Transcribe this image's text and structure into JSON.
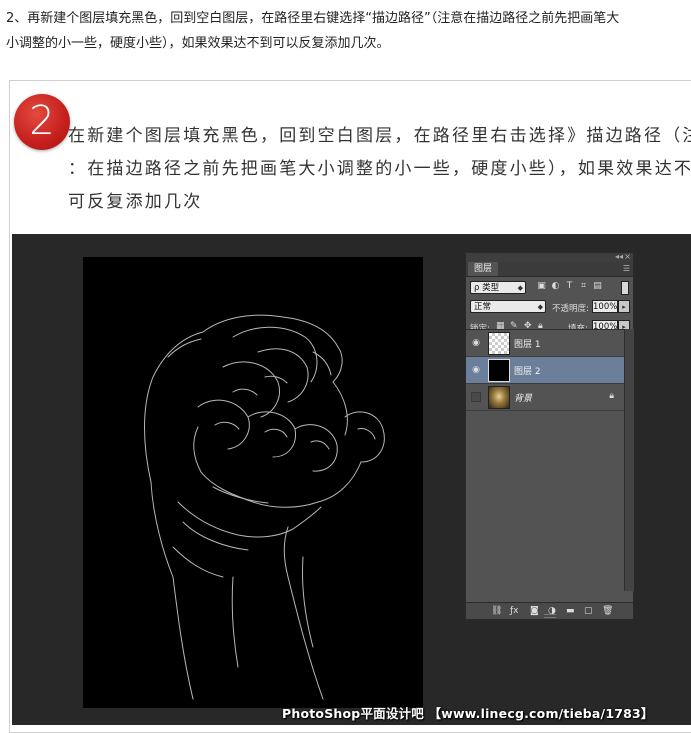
{
  "intro": {
    "line1": "2、再新建个图层填充黑色，回到空白图层，在路径里右键选择“描边路径”（注意在描边路径之前先把画笔大",
    "line2": "小调整的小一些，硬度小些），如果效果达不到可以反复添加几次。"
  },
  "step": {
    "number": "2",
    "line1": "在新建个图层填充黑色，回到空白图层，在路径里右击选择》描边路径（注",
    "line2": "：在描边路径之前先把画笔大小调整的小一些，硬度小些），如果效果达不",
    "line3": "可反复添加几次"
  },
  "layers_panel": {
    "tab": "图层",
    "filter": "ρ 类型",
    "blend_mode": "正常",
    "opacity_label": "不透明度:",
    "opacity_value": "100%",
    "lock_label": "锁定:",
    "fill_label": "填充:",
    "fill_value": "100%",
    "layers": [
      {
        "name": "图层 1",
        "visible": true,
        "selected": false,
        "thumb": "transparent"
      },
      {
        "name": "图层 2",
        "visible": true,
        "selected": true,
        "thumb": "black"
      },
      {
        "name": "背景",
        "visible": false,
        "selected": false,
        "thumb": "photo",
        "locked": true
      }
    ]
  },
  "watermark": "PhotoShop平面设计吧 【www.linecg.com/tieba/1783】",
  "colors": {
    "badge": "#c51f1c",
    "workspace": "#282828",
    "panel": "#535353",
    "selected_layer": "#6b7f9a"
  }
}
